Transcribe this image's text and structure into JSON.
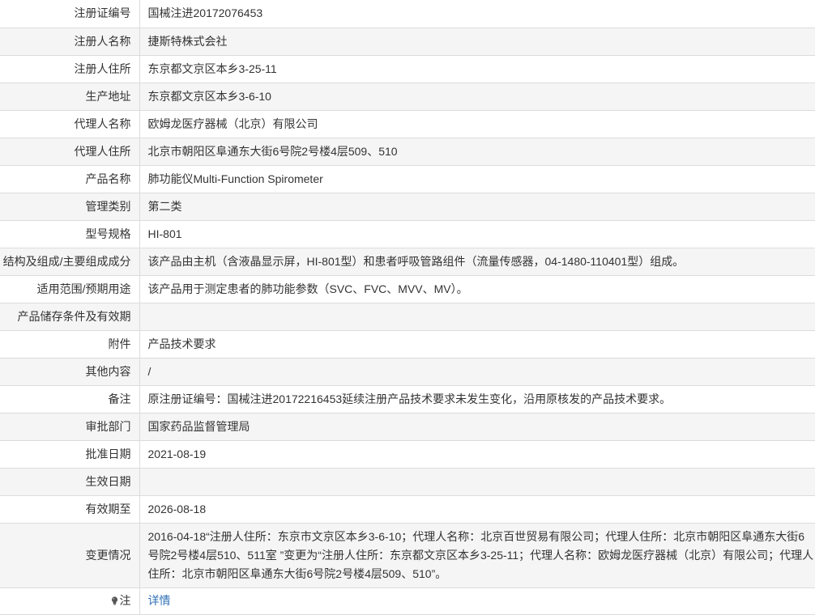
{
  "rows": [
    {
      "label": "注册证编号",
      "value": "国械注进20172076453"
    },
    {
      "label": "注册人名称",
      "value": "捷斯特株式会社"
    },
    {
      "label": "注册人住所",
      "value": "东京都文京区本乡3-25-11"
    },
    {
      "label": "生产地址",
      "value": "东京都文京区本乡3-6-10"
    },
    {
      "label": "代理人名称",
      "value": "欧姆龙医疗器械（北京）有限公司"
    },
    {
      "label": "代理人住所",
      "value": "北京市朝阳区阜通东大街6号院2号楼4层509、510"
    },
    {
      "label": "产品名称",
      "value": "肺功能仪Multi-Function Spirometer"
    },
    {
      "label": "管理类别",
      "value": "第二类"
    },
    {
      "label": "型号规格",
      "value": "HI-801"
    },
    {
      "label": "结构及组成/主要组成成分",
      "value": "该产品由主机（含液晶显示屏，HI-801型）和患者呼吸管路组件（流量传感器，04-1480-110401型）组成。"
    },
    {
      "label": "适用范围/预期用途",
      "value": "该产品用于测定患者的肺功能参数（SVC、FVC、MVV、MV）。"
    },
    {
      "label": "产品储存条件及有效期",
      "value": ""
    },
    {
      "label": "附件",
      "value": "产品技术要求"
    },
    {
      "label": "其他内容",
      "value": "/"
    },
    {
      "label": "备注",
      "value": "原注册证编号：国械注进20172216453延续注册产品技术要求未发生变化，沿用原核发的产品技术要求。"
    },
    {
      "label": "审批部门",
      "value": "国家药品监督管理局"
    },
    {
      "label": "批准日期",
      "value": "2021-08-19"
    },
    {
      "label": "生效日期",
      "value": ""
    },
    {
      "label": "有效期至",
      "value": "2026-08-18"
    },
    {
      "label": "变更情况",
      "value": "2016-04-18“注册人住所：东京市文京区本乡3-6-10；代理人名称：北京百世贸易有限公司；代理人住所：北京市朝阳区阜通东大街6号院2号楼4层510、511室 ”变更为“注册人住所：东京都文京区本乡3-25-11；代理人名称：欧姆龙医疗器械（北京）有限公司；代理人住所：北京市朝阳区阜通东大街6号院2号楼4层509、510”。"
    }
  ],
  "note": {
    "icon": "lightbulb-icon",
    "label": "注",
    "link_text": "详情",
    "link_color": "#2f6fb5"
  }
}
